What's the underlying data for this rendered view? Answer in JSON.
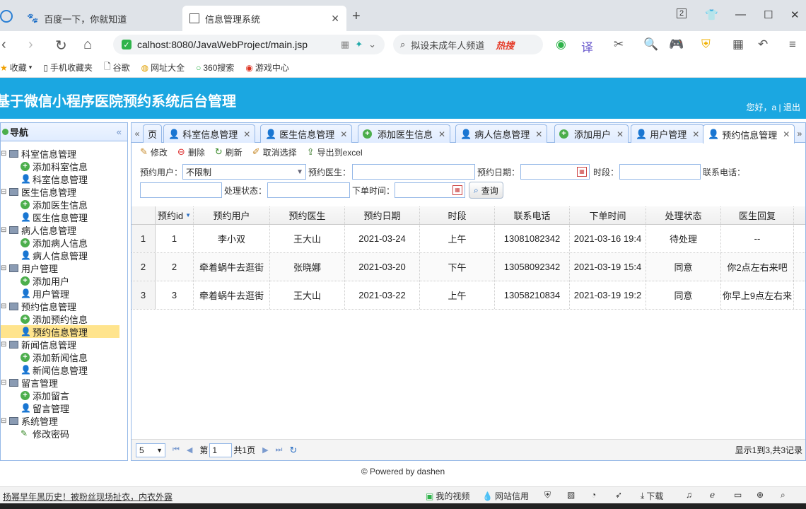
{
  "browser": {
    "tabs": [
      {
        "title": "百度一下，你就知道",
        "icon": "baidu-paw-icon"
      },
      {
        "title": "信息管理系统",
        "icon": "page-icon"
      }
    ],
    "tab_count": "2",
    "url": "calhost:8080/JavaWebProject/main.jsp",
    "search_placeholder": "拟设未成年人频道",
    "search_hot": "热搜"
  },
  "bookmarks": [
    {
      "label": "收藏",
      "icon": "star-icon"
    },
    {
      "label": "手机收藏夹",
      "icon": "phone-icon"
    },
    {
      "label": "谷歌",
      "icon": "doc-icon"
    },
    {
      "label": "网址大全",
      "icon": "globe-icon"
    },
    {
      "label": "360搜索",
      "icon": "ring-icon"
    },
    {
      "label": "游戏中心",
      "icon": "game-icon"
    }
  ],
  "app": {
    "title": "基于微信小程序医院预约系统后台管理",
    "welcome": "您好，a | 退出"
  },
  "nav": {
    "title": "导航",
    "groups": [
      {
        "label": "科室信息管理",
        "children": [
          {
            "label": "添加科室信息",
            "icon": "add"
          },
          {
            "label": "科室信息管理",
            "icon": "user"
          }
        ]
      },
      {
        "label": "医生信息管理",
        "children": [
          {
            "label": "添加医生信息",
            "icon": "add"
          },
          {
            "label": "医生信息管理",
            "icon": "user"
          }
        ]
      },
      {
        "label": "病人信息管理",
        "children": [
          {
            "label": "添加病人信息",
            "icon": "add"
          },
          {
            "label": "病人信息管理",
            "icon": "user"
          }
        ]
      },
      {
        "label": "用户管理",
        "children": [
          {
            "label": "添加用户",
            "icon": "add"
          },
          {
            "label": "用户管理",
            "icon": "user"
          }
        ]
      },
      {
        "label": "预约信息管理",
        "children": [
          {
            "label": "添加预约信息",
            "icon": "add"
          },
          {
            "label": "预约信息管理",
            "icon": "user",
            "selected": true
          }
        ]
      },
      {
        "label": "新闻信息管理",
        "children": [
          {
            "label": "添加新闻信息",
            "icon": "add"
          },
          {
            "label": "新闻信息管理",
            "icon": "user"
          }
        ]
      },
      {
        "label": "留言管理",
        "children": [
          {
            "label": "添加留言",
            "icon": "add"
          },
          {
            "label": "留言管理",
            "icon": "user"
          }
        ]
      },
      {
        "label": "系统管理",
        "children": [
          {
            "label": "修改密码",
            "icon": "pen"
          }
        ]
      }
    ]
  },
  "panel_tabs": [
    {
      "label": "页",
      "icon": ""
    },
    {
      "label": "科室信息管理",
      "icon": "user"
    },
    {
      "label": "医生信息管理",
      "icon": "user"
    },
    {
      "label": "添加医生信息",
      "icon": "add"
    },
    {
      "label": "病人信息管理",
      "icon": "user"
    },
    {
      "label": "添加用户",
      "icon": "add"
    },
    {
      "label": "用户管理",
      "icon": "user"
    },
    {
      "label": "预约信息管理",
      "icon": "user",
      "active": true
    }
  ],
  "toolbar": {
    "edit": "修改",
    "delete": "删除",
    "refresh": "刷新",
    "unselect": "取消选择",
    "export": "导出到excel"
  },
  "filters": {
    "user_label": "预约用户：",
    "user_value": "不限制",
    "doctor_label": "预约医生：",
    "date_label": "预约日期：",
    "period_label": "时段：",
    "phone_label": "联系电话：",
    "status_label": "处理状态：",
    "order_time_label": "下单时间：",
    "query": "查询"
  },
  "grid": {
    "columns": [
      "预约id",
      "预约用户",
      "预约医生",
      "预约日期",
      "时段",
      "联系电话",
      "下单时间",
      "处理状态",
      "医生回复"
    ],
    "rows": [
      {
        "n": "1",
        "cells": [
          "1",
          "李小双",
          "王大山",
          "2021-03-24",
          "上午",
          "13081082342",
          "2021-03-16 19:4",
          "待处理",
          "--"
        ]
      },
      {
        "n": "2",
        "cells": [
          "2",
          "牵着蜗牛去逛街",
          "张晓娜",
          "2021-03-20",
          "下午",
          "13058092342",
          "2021-03-19 15:4",
          "同意",
          "你2点左右来吧"
        ]
      },
      {
        "n": "3",
        "cells": [
          "3",
          "牵着蜗牛去逛街",
          "王大山",
          "2021-03-22",
          "上午",
          "13058210834",
          "2021-03-19 19:2",
          "同意",
          "你早上9点左右来"
        ]
      }
    ]
  },
  "pager": {
    "page_size": "5",
    "page_prefix": "第",
    "page_value": "1",
    "page_total": "共1页",
    "info": "显示1到3,共3记录"
  },
  "footer": "© Powered by dashen",
  "statusbar": {
    "news": "扬幂早年黑历史！被粉丝现场扯衣，内衣外露",
    "video": "我的视频",
    "credit": "网站信用",
    "download": "下载"
  }
}
